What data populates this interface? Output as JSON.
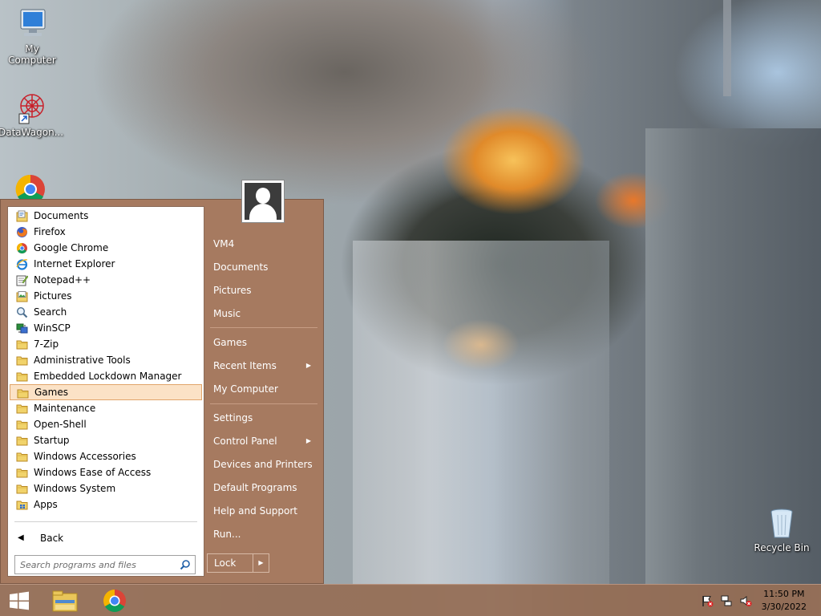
{
  "desktop": {
    "icons": [
      {
        "label": "My Computer"
      },
      {
        "label": "DataWagon..."
      },
      {
        "label": "Recycle Bin"
      }
    ]
  },
  "start_menu": {
    "programs": [
      {
        "label": "Documents",
        "icon": "documents-folder-icon"
      },
      {
        "label": "Firefox",
        "icon": "firefox-icon"
      },
      {
        "label": "Google Chrome",
        "icon": "chrome-icon"
      },
      {
        "label": "Internet Explorer",
        "icon": "internet-explorer-icon"
      },
      {
        "label": "Notepad++",
        "icon": "notepad-plus-icon"
      },
      {
        "label": "Pictures",
        "icon": "pictures-icon"
      },
      {
        "label": "Search",
        "icon": "search-icon"
      },
      {
        "label": "WinSCP",
        "icon": "winscp-icon"
      },
      {
        "label": "7-Zip",
        "icon": "folder-icon"
      },
      {
        "label": "Administrative Tools",
        "icon": "folder-icon"
      },
      {
        "label": "Embedded Lockdown Manager",
        "icon": "folder-icon"
      },
      {
        "label": "Games",
        "icon": "folder-icon",
        "selected": true
      },
      {
        "label": "Maintenance",
        "icon": "folder-icon"
      },
      {
        "label": "Open-Shell",
        "icon": "folder-icon"
      },
      {
        "label": "Startup",
        "icon": "folder-icon"
      },
      {
        "label": "Windows Accessories",
        "icon": "folder-icon"
      },
      {
        "label": "Windows Ease of Access",
        "icon": "folder-icon"
      },
      {
        "label": "Windows System",
        "icon": "folder-icon"
      },
      {
        "label": "Apps",
        "icon": "apps-icon"
      }
    ],
    "back_label": "Back",
    "search_placeholder": "Search programs and files",
    "right_items": [
      {
        "label": "VM4"
      },
      {
        "label": "Documents"
      },
      {
        "label": "Pictures"
      },
      {
        "label": "Music"
      },
      {
        "label": "Games"
      },
      {
        "label": "Recent Items",
        "submenu": true
      },
      {
        "label": "My Computer"
      },
      {
        "label": "Settings"
      },
      {
        "label": "Control Panel",
        "submenu": true
      },
      {
        "label": "Devices and Printers"
      },
      {
        "label": "Default Programs"
      },
      {
        "label": "Help and Support"
      },
      {
        "label": "Run..."
      }
    ],
    "lock_label": "Lock"
  },
  "taskbar": {
    "time": "11:50 PM",
    "date": "3/30/2022"
  },
  "colors": {
    "menu_bg": "#a67a60",
    "selected_bg": "#fbe2c6",
    "selected_border": "#e1a56b"
  }
}
